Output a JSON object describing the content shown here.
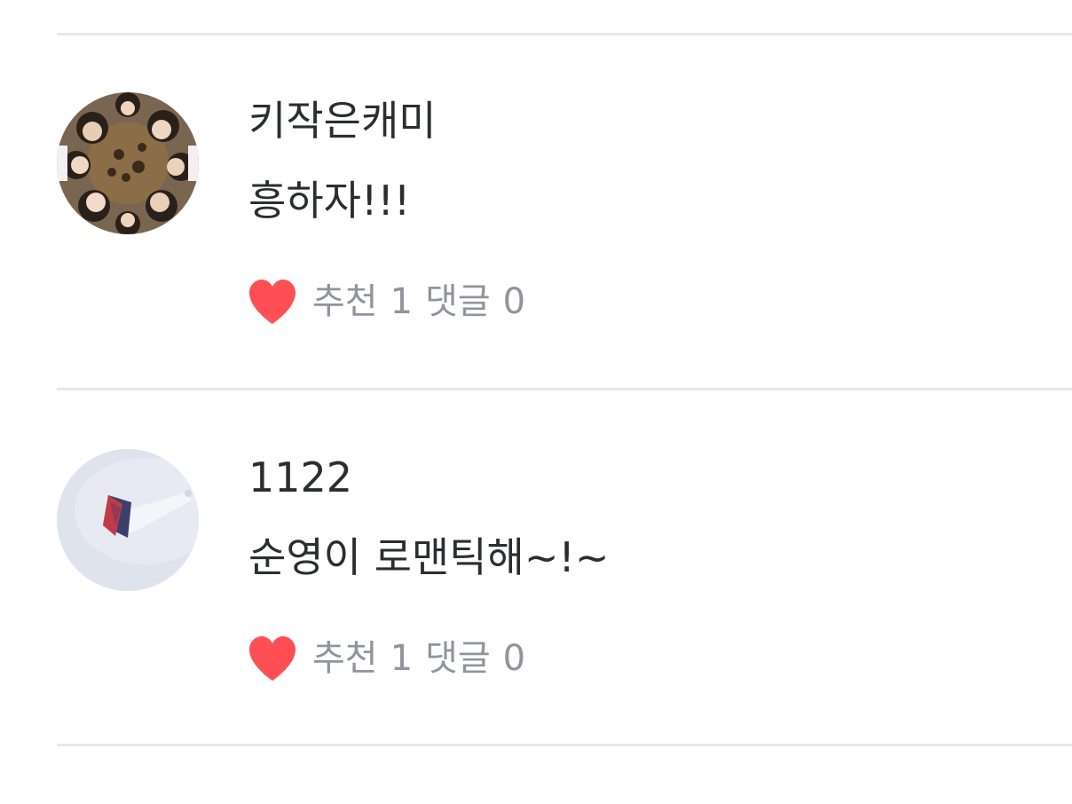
{
  "comments": [
    {
      "author": "키작은캐미",
      "text": "흥하자!!!",
      "like_label": "추천",
      "like_count": "1",
      "reply_label": "댓글",
      "reply_count": "0",
      "avatar_icon": "group-photo-avatar"
    },
    {
      "author": "1122",
      "text": "순영이 로맨틱해~!~",
      "like_label": "추천",
      "like_count": "1",
      "reply_label": "댓글",
      "reply_count": "0",
      "avatar_icon": "lightstick-photo-avatar"
    }
  ],
  "colors": {
    "heart": "#ff4f55",
    "divider": "#e6e7e9",
    "text_primary": "#2b2d31",
    "text_meta": "#8f959c"
  }
}
